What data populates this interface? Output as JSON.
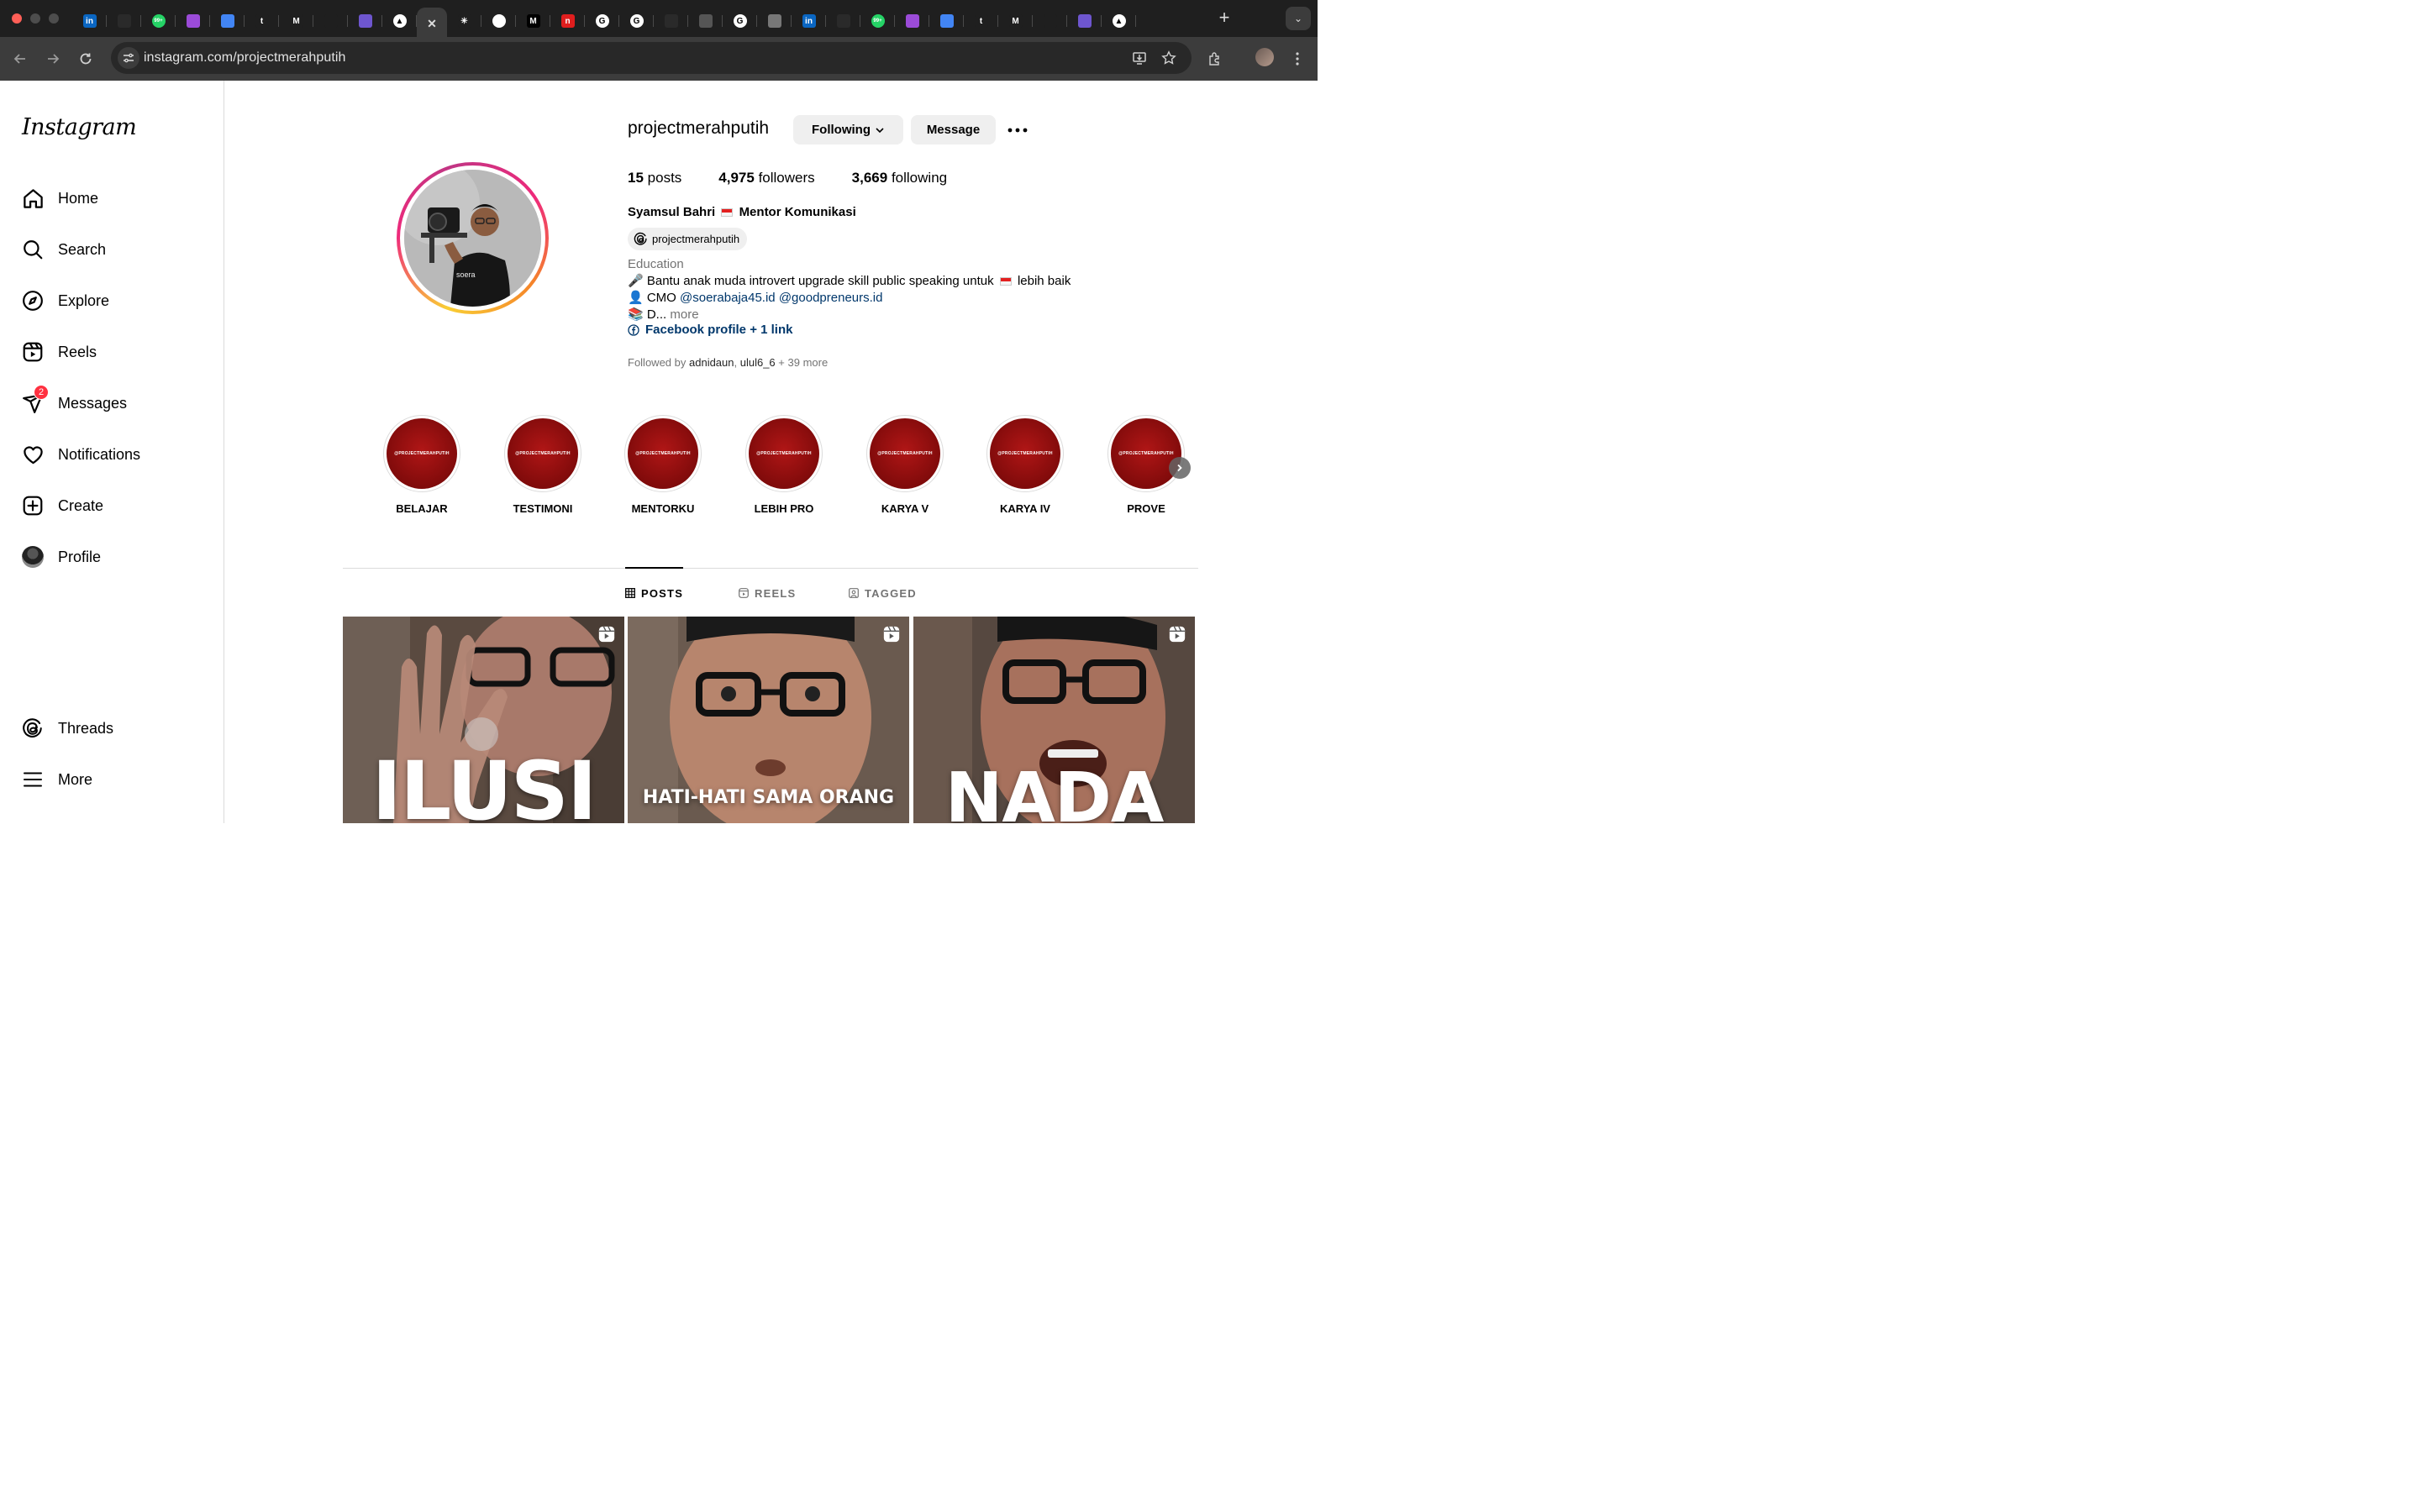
{
  "browser": {
    "tabs": [
      {
        "name": "linkedin-tab",
        "icon": "linkedin-icon",
        "glyph": "in",
        "color": "#0a66c2"
      },
      {
        "name": "github-tab",
        "icon": "github-icon",
        "glyph": "",
        "color": "#2a2a2a"
      },
      {
        "name": "whatsapp-tab",
        "icon": "whatsapp-icon",
        "glyph": "99+",
        "color": "#25d366"
      },
      {
        "name": "trello-tab",
        "icon": "trello-icon",
        "glyph": "",
        "color": "#9b4bd8"
      },
      {
        "name": "docs-tab",
        "icon": "docs-icon",
        "glyph": "",
        "color": "#4285f4"
      },
      {
        "name": "t-tab",
        "icon": "t-logo-icon",
        "glyph": "t",
        "color": "#1f1f1f"
      },
      {
        "name": "gmail-tab",
        "icon": "gmail-icon",
        "glyph": "M",
        "color": "#1f1f1f"
      },
      {
        "name": "bar-tab",
        "icon": "bar-icon",
        "glyph": "",
        "color": "#1f1f1f"
      },
      {
        "name": "list-tab",
        "icon": "list-icon",
        "glyph": "",
        "color": "#6e56cf"
      },
      {
        "name": "vercel-tab",
        "icon": "triangle-icon",
        "glyph": "▲",
        "color": "#fff"
      },
      {
        "name": "instagram-tab",
        "icon": "close-icon",
        "glyph": "✕",
        "color": "transparent",
        "active": true
      },
      {
        "name": "claude-tab",
        "icon": "sparkle-icon",
        "glyph": "✳",
        "color": "#1f1f1f"
      },
      {
        "name": "chatgpt-tab",
        "icon": "chatgpt-icon",
        "glyph": "",
        "color": "#fff"
      },
      {
        "name": "medium-tab",
        "icon": "medium-icon",
        "glyph": "M",
        "color": "#000"
      },
      {
        "name": "notion-tab",
        "icon": "notion-icon",
        "glyph": "n",
        "color": "#e01e1e"
      },
      {
        "name": "google-tab-1",
        "icon": "google-icon",
        "glyph": "G",
        "color": "#fff"
      },
      {
        "name": "google-tab-2",
        "icon": "google-icon",
        "glyph": "G",
        "color": "#fff"
      },
      {
        "name": "github-tab-2",
        "icon": "github-icon",
        "glyph": "",
        "color": "#2a2a2a"
      },
      {
        "name": "globe-tab",
        "icon": "globe-icon",
        "glyph": "",
        "color": "#555"
      },
      {
        "name": "google-tab-3",
        "icon": "google-icon",
        "glyph": "G",
        "color": "#fff"
      },
      {
        "name": "chrome-tab",
        "icon": "chrome-icon",
        "glyph": "",
        "color": "#777"
      },
      {
        "name": "linkedin-tab-2",
        "icon": "linkedin-icon",
        "glyph": "in",
        "color": "#0a66c2"
      },
      {
        "name": "github-tab-3",
        "icon": "github-icon",
        "glyph": "",
        "color": "#2a2a2a"
      },
      {
        "name": "whatsapp-tab-2",
        "icon": "whatsapp-icon",
        "glyph": "99+",
        "color": "#25d366"
      },
      {
        "name": "trello-tab-2",
        "icon": "trello-icon",
        "glyph": "",
        "color": "#9b4bd8"
      },
      {
        "name": "docs-tab-2",
        "icon": "docs-icon",
        "glyph": "",
        "color": "#4285f4"
      },
      {
        "name": "t-tab-2",
        "icon": "t-logo-icon",
        "glyph": "t",
        "color": "#1f1f1f"
      },
      {
        "name": "gmail-tab-2",
        "icon": "gmail-icon",
        "glyph": "M",
        "color": "#1f1f1f"
      },
      {
        "name": "bar-tab-2",
        "icon": "bar-icon",
        "glyph": "",
        "color": "#1f1f1f"
      },
      {
        "name": "list-tab-2",
        "icon": "list-icon",
        "glyph": "",
        "color": "#6e56cf"
      },
      {
        "name": "vercel-tab-2",
        "icon": "triangle-icon",
        "glyph": "▲",
        "color": "#fff"
      }
    ],
    "url": "instagram.com/projectmerahputih"
  },
  "sidebar": {
    "logo": "Instagram",
    "items": [
      {
        "id": "home",
        "label": "Home"
      },
      {
        "id": "search",
        "label": "Search"
      },
      {
        "id": "explore",
        "label": "Explore"
      },
      {
        "id": "reels",
        "label": "Reels"
      },
      {
        "id": "messages",
        "label": "Messages",
        "badge": "2"
      },
      {
        "id": "notifications",
        "label": "Notifications"
      },
      {
        "id": "create",
        "label": "Create"
      },
      {
        "id": "profile",
        "label": "Profile"
      }
    ],
    "bottom": [
      {
        "id": "threads",
        "label": "Threads"
      },
      {
        "id": "more",
        "label": "More"
      }
    ]
  },
  "profile": {
    "username": "projectmerahputih",
    "following_button": "Following",
    "message_button": "Message",
    "stats": {
      "posts_count": "15",
      "posts_label": "posts",
      "followers_count": "4,975",
      "followers_label": "followers",
      "following_count": "3,669",
      "following_label": "following"
    },
    "full_name_a": "Syamsul Bahri",
    "full_name_b": "Mentor Komunikasi",
    "threads_handle": "projectmerahputih",
    "category": "Education",
    "bio_1": "🎤 Bantu anak muda introvert upgrade skill public speaking untuk",
    "bio_1b": "lebih baik",
    "bio_2_prefix": "👤 CMO",
    "bio_2_mention_1": "@soerabaja45.id",
    "bio_2_mention_2": "@goodpreneurs.id",
    "bio_3": "📚 D...",
    "bio_more": "more",
    "link_text": "Facebook profile + 1 link",
    "followed_by_prefix": "Followed by",
    "followed_by_1": "adnidaun",
    "followed_by_2": "ulul6_6",
    "followed_by_more": "+ 39 more"
  },
  "highlights": {
    "cover_text": "@PROJECTMERAHPUTIH",
    "items": [
      "BELAJAR",
      "TESTIMONI",
      "MENTORKU",
      "LEBIH PRO",
      "KARYA V",
      "KARYA IV",
      "PROVE"
    ]
  },
  "tabs": {
    "posts": "POSTS",
    "reels": "REELS",
    "tagged": "TAGGED"
  },
  "posts": [
    {
      "caption": "ILUSI"
    },
    {
      "caption": "HATI-HATI SAMA ORANG"
    },
    {
      "caption": "NADA"
    }
  ],
  "colors": {
    "accent_link": "#00376b",
    "badge_red": "#ff3040",
    "highlight_red": "#9b0f0f"
  }
}
